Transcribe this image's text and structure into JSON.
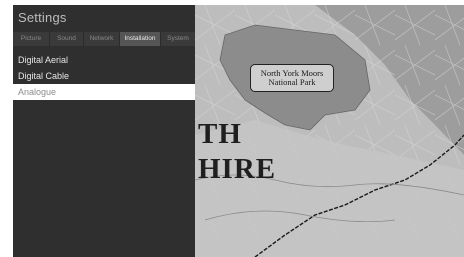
{
  "panel": {
    "title": "Settings",
    "tabs": [
      {
        "label": "Picture",
        "active": false
      },
      {
        "label": "Sound",
        "active": false
      },
      {
        "label": "Network",
        "active": false
      },
      {
        "label": "Installation",
        "active": true
      },
      {
        "label": "System",
        "active": false
      }
    ],
    "menu_items": [
      {
        "label": "Digital Aerial",
        "selected": false
      },
      {
        "label": "Digital Cable",
        "selected": false
      },
      {
        "label": "Analogue",
        "selected": true
      }
    ]
  },
  "background_map": {
    "park_label_line1": "North York Moors",
    "park_label_line2": "National Park",
    "region_text_line1": "TH",
    "region_text_line2": "HIRE"
  },
  "colors": {
    "panel_background": "#2f2f2f",
    "tab_strip": "#3a3a3a",
    "active_tab": "#555555",
    "selected_item_background": "#ffffff",
    "map_land": "#b7b7b7",
    "national_park": "#8f8f8f"
  }
}
